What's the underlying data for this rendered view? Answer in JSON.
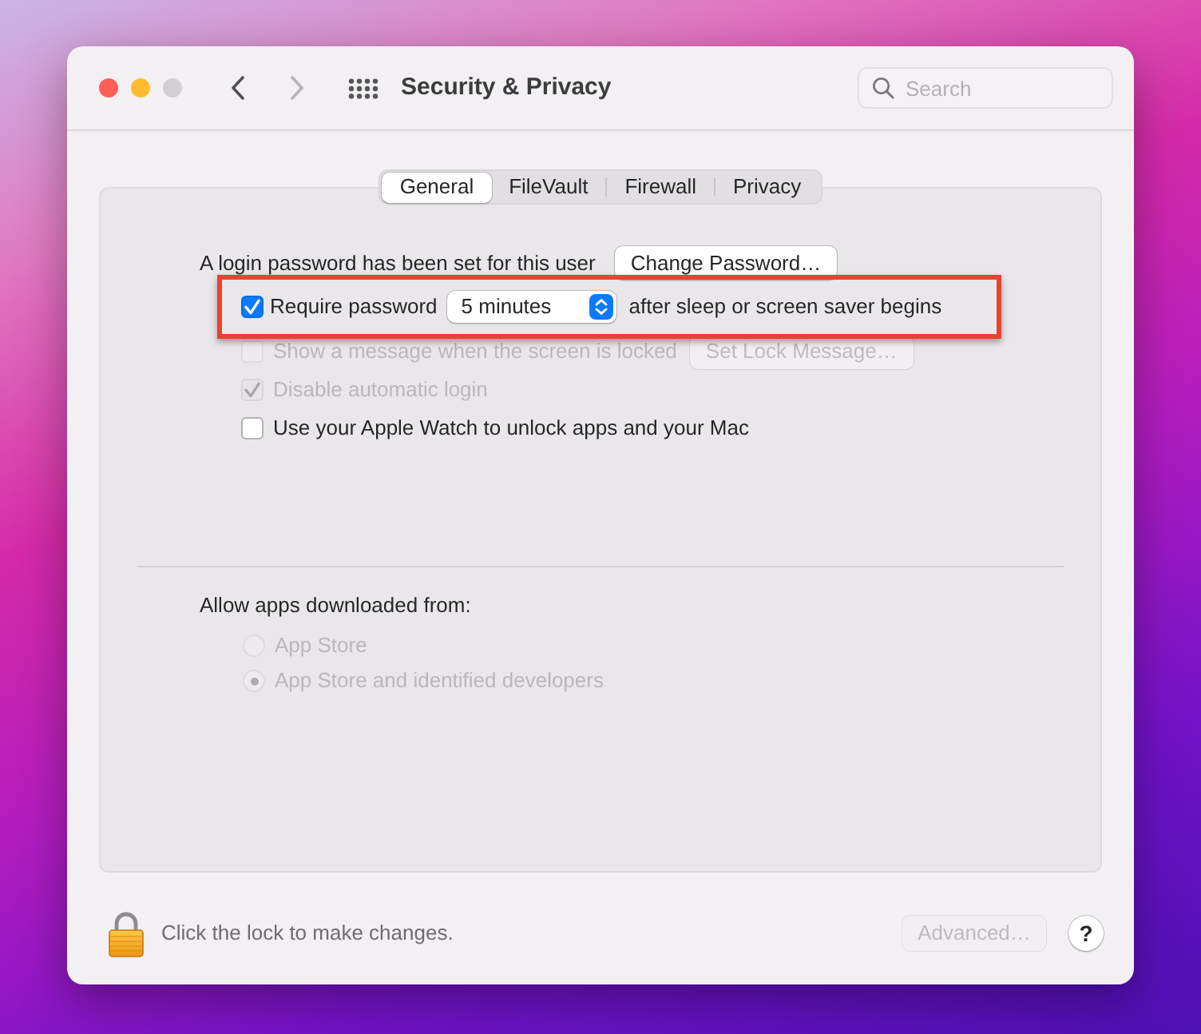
{
  "window": {
    "title": "Security & Privacy",
    "controls": [
      {
        "kind": "close",
        "disabled": false
      },
      {
        "kind": "minimize",
        "disabled": false
      },
      {
        "kind": "zoom",
        "disabled": true
      }
    ]
  },
  "navigation": {
    "back": {
      "disabled": false
    },
    "forward": {
      "disabled": true
    }
  },
  "search": {
    "placeholder": "Search"
  },
  "tabs": [
    {
      "label": "General",
      "selected": true
    },
    {
      "label": "FileVault",
      "selected": false
    },
    {
      "label": "Firewall",
      "selected": false
    },
    {
      "label": "Privacy",
      "selected": false
    }
  ],
  "general": {
    "login_status": "A login password has been set for this user",
    "change_password": {
      "label": "Change Password…",
      "disabled": false
    },
    "options": [
      {
        "kind": "popup",
        "label": "Require password",
        "checked": true,
        "disabled": false,
        "highlighted": true,
        "popup": "5 minutes",
        "suffix": "after sleep or screen saver begins"
      },
      {
        "kind": "button",
        "label": "Show a message when the screen is locked",
        "checked": false,
        "disabled": true,
        "highlighted": false,
        "button": {
          "label": "Set Lock Message…",
          "disabled": true
        }
      },
      {
        "kind": "plain",
        "label": "Disable automatic login",
        "checked": true,
        "disabled": true,
        "highlighted": false
      },
      {
        "kind": "plain",
        "label": "Use your Apple Watch to unlock apps and your Mac",
        "checked": false,
        "disabled": false,
        "highlighted": false
      }
    ],
    "downloads": {
      "label": "Allow apps downloaded from:",
      "options": [
        {
          "label": "App Store",
          "selected": false,
          "disabled": true
        },
        {
          "label": "App Store and identified developers",
          "selected": true,
          "disabled": true
        }
      ]
    }
  },
  "footer": {
    "lock_message": "Click the lock to make changes.",
    "advanced": {
      "label": "Advanced…",
      "disabled": true
    },
    "help": "?"
  }
}
